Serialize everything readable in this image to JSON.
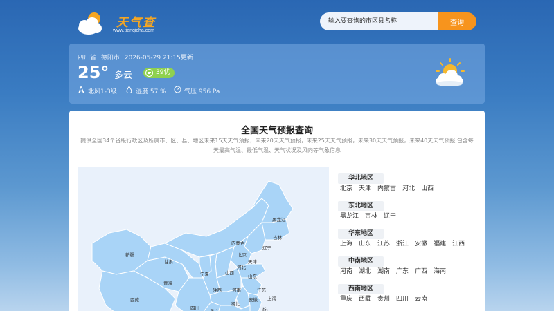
{
  "header": {
    "logo_title": "天气查",
    "logo_url": "www.tianqicha.com",
    "search_placeholder": "输入要查询的市区县名称",
    "search_button": "查询"
  },
  "weather": {
    "province": "四川省",
    "city": "德阳市",
    "updated": "2026-05-29 21:15更新",
    "temperature": "25°",
    "condition": "多云",
    "aqi": "39优",
    "wind": "北风1-3级",
    "humidity": "湿度 57 %",
    "pressure": "气压 956 Pa"
  },
  "main": {
    "title": "全国天气预报查询",
    "description": "提供全国34个省级行政区及所属市、区、县、地区未来15天天气预报，未来20天天气预报，未来25天天气预报，未来30天天气预报，未来40天天气预报,包含每天最高气温、最低气温、天气状况及风向等气象信息"
  },
  "map_labels": [
    "黑龙江",
    "吉林",
    "内蒙古",
    "辽宁",
    "北京",
    "天津",
    "新疆",
    "甘肃",
    "河北",
    "宁夏",
    "山西",
    "山东",
    "青海",
    "陕西",
    "河南",
    "江苏",
    "西藏",
    "湖北",
    "安徽",
    "上海",
    "四川",
    "重庆",
    "浙江"
  ],
  "regions": [
    {
      "title": "华北地区",
      "items": [
        "北京",
        "天津",
        "内蒙古",
        "河北",
        "山西"
      ]
    },
    {
      "title": "东北地区",
      "items": [
        "黑龙江",
        "吉林",
        "辽宁"
      ]
    },
    {
      "title": "华东地区",
      "items": [
        "上海",
        "山东",
        "江苏",
        "浙江",
        "安徽",
        "福建",
        "江西"
      ]
    },
    {
      "title": "中南地区",
      "items": [
        "河南",
        "湖北",
        "湖南",
        "广东",
        "广西",
        "海南"
      ]
    },
    {
      "title": "西南地区",
      "items": [
        "重庆",
        "西藏",
        "贵州",
        "四川",
        "云南"
      ]
    }
  ],
  "colors": {
    "accent": "#f7941d",
    "aqi_good": "#8fd14f",
    "map_fill": "#a9d4f7"
  },
  "icons": [
    "cloud-sun-logo-icon",
    "air-quality-icon",
    "wind-icon",
    "humidity-icon",
    "pressure-icon",
    "partly-cloudy-icon"
  ]
}
